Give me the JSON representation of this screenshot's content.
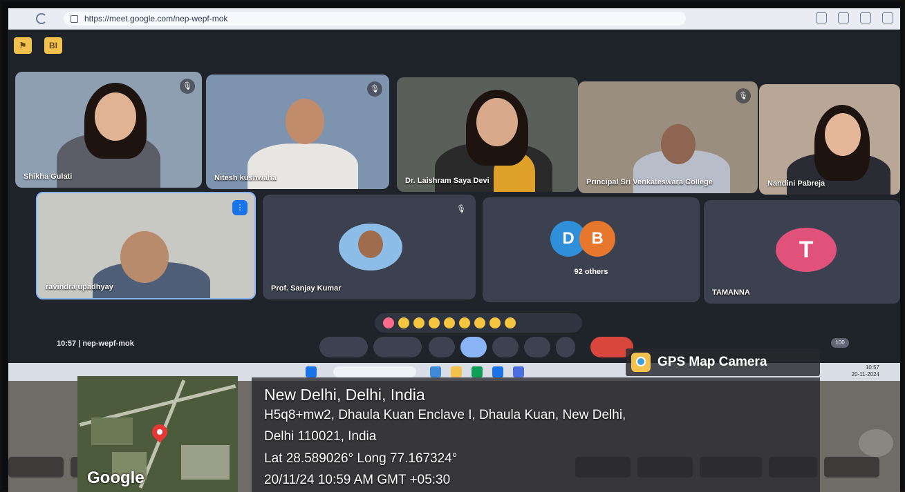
{
  "browser": {
    "url": "https://meet.google.com/nep-wepf-mok"
  },
  "toolbar_buttons": [
    "BI"
  ],
  "participants": [
    {
      "name": "Shikha Gulati",
      "muted": true
    },
    {
      "name": "Nitesh kushwaha",
      "muted": true
    },
    {
      "name": "Dr. Laishram Saya Devi",
      "muted": false
    },
    {
      "name": "Principal Sri Venkateswara College",
      "muted": true
    },
    {
      "name": "Nandini Pabreja",
      "muted": false
    },
    {
      "name": "ravindra upadhyay",
      "muted": false
    },
    {
      "name": "Prof. Sanjay Kumar",
      "muted": true
    },
    {
      "name": "92 others",
      "avatars": [
        "D",
        "B"
      ]
    },
    {
      "name": "TAMANNA",
      "avatar": "T"
    }
  ],
  "meeting": {
    "time_code": "10:57 | nep-wepf-mok",
    "participant_count": "100"
  },
  "taskbar": {
    "clock": "10:57",
    "date": "20-11-2024"
  },
  "gps": {
    "badge": "GPS Map Camera",
    "map_label": "Google",
    "location": "New Delhi, Delhi, India",
    "address1": "H5q8+mw2, Dhaula Kuan Enclave I, Dhaula Kuan, New Delhi,",
    "address2": "Delhi 110021, India",
    "coords": "Lat 28.589026° Long 77.167324°",
    "datetime": "20/11/24 10:59 AM GMT +05:30"
  },
  "colors": {
    "avatar_d": "#2f8fd8",
    "avatar_b": "#e8772e",
    "avatar_t": "#e0527a",
    "end_call": "#d9463b"
  }
}
